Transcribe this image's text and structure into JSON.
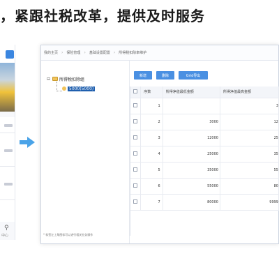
{
  "headline": "，紧跟社税改革，提供及时服务",
  "breadcrumbs": [
    "我的主页",
    "保险管理",
    "基础设置配置",
    "所得税扣除率维护"
  ],
  "tree": {
    "root_label": "所得税扣除组",
    "child_label": "5000(5000)"
  },
  "toolbar": {
    "add_label": "新增",
    "delete_label": "删除",
    "export_label": "Grid导出"
  },
  "table": {
    "columns": [
      "序数",
      "所得净值最低金额",
      "所得净值最高金额"
    ],
    "rows": [
      {
        "seq": "1",
        "low": "",
        "high": "3"
      },
      {
        "seq": "2",
        "low": "3000",
        "high": "12"
      },
      {
        "seq": "3",
        "low": "12000",
        "high": "25"
      },
      {
        "seq": "4",
        "low": "25000",
        "high": "35"
      },
      {
        "seq": "5",
        "low": "35000",
        "high": "55"
      },
      {
        "seq": "6",
        "low": "55000",
        "high": "80"
      },
      {
        "seq": "7",
        "low": "80000",
        "high": "9999"
      }
    ]
  },
  "footer_note": "* 标签左上角图标可以进行相关业务操作",
  "phone_icon_label": "中心",
  "colors": {
    "accent": "#4a90e2",
    "arrow": "#4aa3e8",
    "tree_selected": "#1f5fae"
  }
}
